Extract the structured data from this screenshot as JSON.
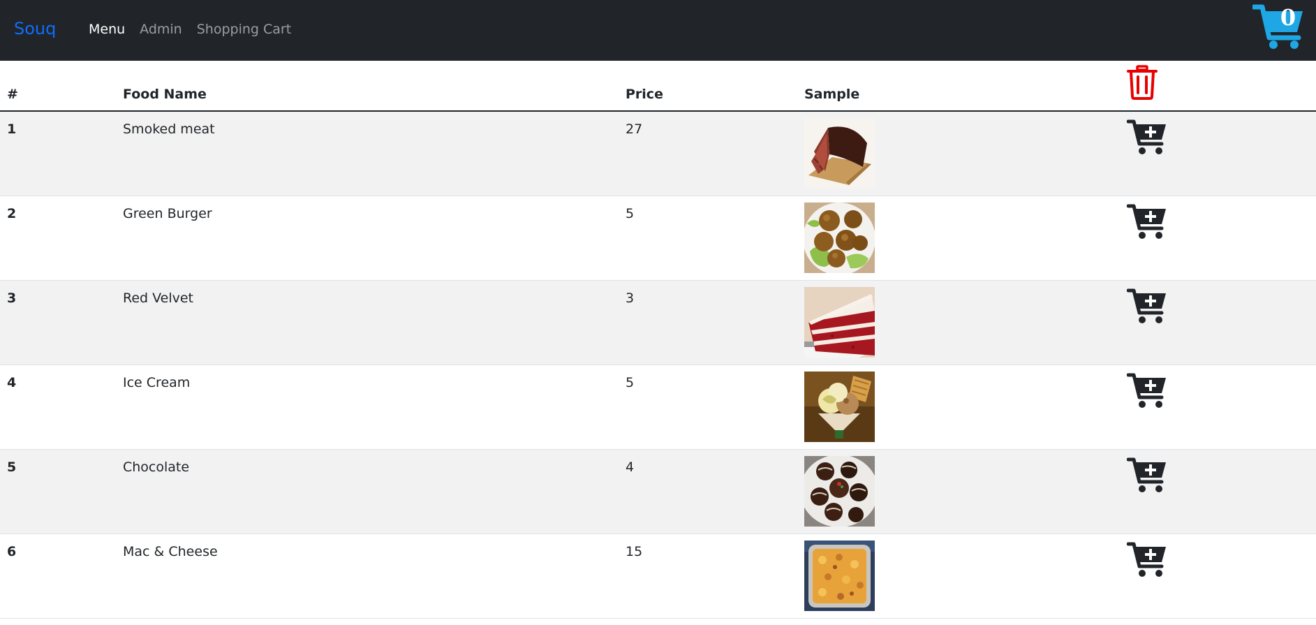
{
  "navbar": {
    "brand": "Souq",
    "links": [
      {
        "label": "Menu",
        "active": true
      },
      {
        "label": "Admin",
        "active": false
      },
      {
        "label": "Shopping Cart",
        "active": false
      }
    ],
    "cart_icon": "shopping-cart-icon",
    "cart_count": "0",
    "cart_color": "#1ea7e4"
  },
  "table": {
    "headers": {
      "num": "#",
      "name": "Food Name",
      "price": "Price",
      "sample": "Sample"
    },
    "clear_icon": "trash-icon",
    "clear_color": "#e80000",
    "add_icon": "cart-plus-icon",
    "rows": [
      {
        "num": "1",
        "name": "Smoked meat",
        "price": "27",
        "sample": "smoked-meat-image"
      },
      {
        "num": "2",
        "name": "Green Burger",
        "price": "5",
        "sample": "green-burger-image"
      },
      {
        "num": "3",
        "name": "Red Velvet",
        "price": "3",
        "sample": "red-velvet-image"
      },
      {
        "num": "4",
        "name": "Ice Cream",
        "price": "5",
        "sample": "ice-cream-image"
      },
      {
        "num": "5",
        "name": "Chocolate",
        "price": "4",
        "sample": "chocolate-image"
      },
      {
        "num": "6",
        "name": "Mac & Cheese",
        "price": "15",
        "sample": "mac-and-cheese-image"
      }
    ]
  }
}
